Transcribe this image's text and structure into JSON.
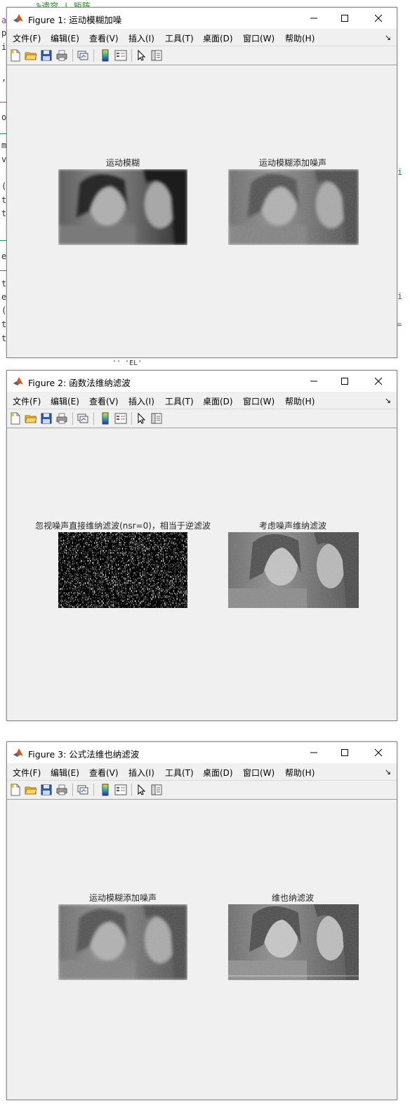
{
  "menu_labels": [
    "文件(F)",
    "编辑(E)",
    "查看(V)",
    "插入(I)",
    "工具(T)",
    "桌面(D)",
    "窗口(W)",
    "帮助(H)"
  ],
  "background_editor": {
    "snippet": "%遗容 | 矩阵",
    "under_fig2": "'' 'EL'"
  },
  "figures": [
    {
      "title": "Figure 1: 运动模糊加噪",
      "axes": [
        {
          "title": "运动模糊"
        },
        {
          "title": "运动模糊添加噪声"
        }
      ]
    },
    {
      "title": "Figure 2: 函数法维纳滤波",
      "axes": [
        {
          "title": "忽视噪声直接维纳滤波(nsr=0)，相当于逆滤波"
        },
        {
          "title": "考虑噪声维纳滤波"
        }
      ]
    },
    {
      "title": "Figure 3: 公式法维也纳滤波",
      "axes": [
        {
          "title": "运动模糊添加噪声"
        },
        {
          "title": "维也纳滤波"
        }
      ]
    }
  ],
  "colors": {
    "figure_background": "#f0f0f0",
    "titlebar": "#ffffff",
    "matlab_icon_orange": "#d95319"
  },
  "icons": {
    "window": [
      "matlab-icon",
      "minimize-icon",
      "maximize-icon",
      "close-icon"
    ],
    "toolbar": [
      "new-figure-icon",
      "open-file-icon",
      "save-icon",
      "print-icon",
      "link-plot-icon",
      "colorbar-icon",
      "legend-icon",
      "edit-plot-icon",
      "property-inspector-icon"
    ]
  }
}
